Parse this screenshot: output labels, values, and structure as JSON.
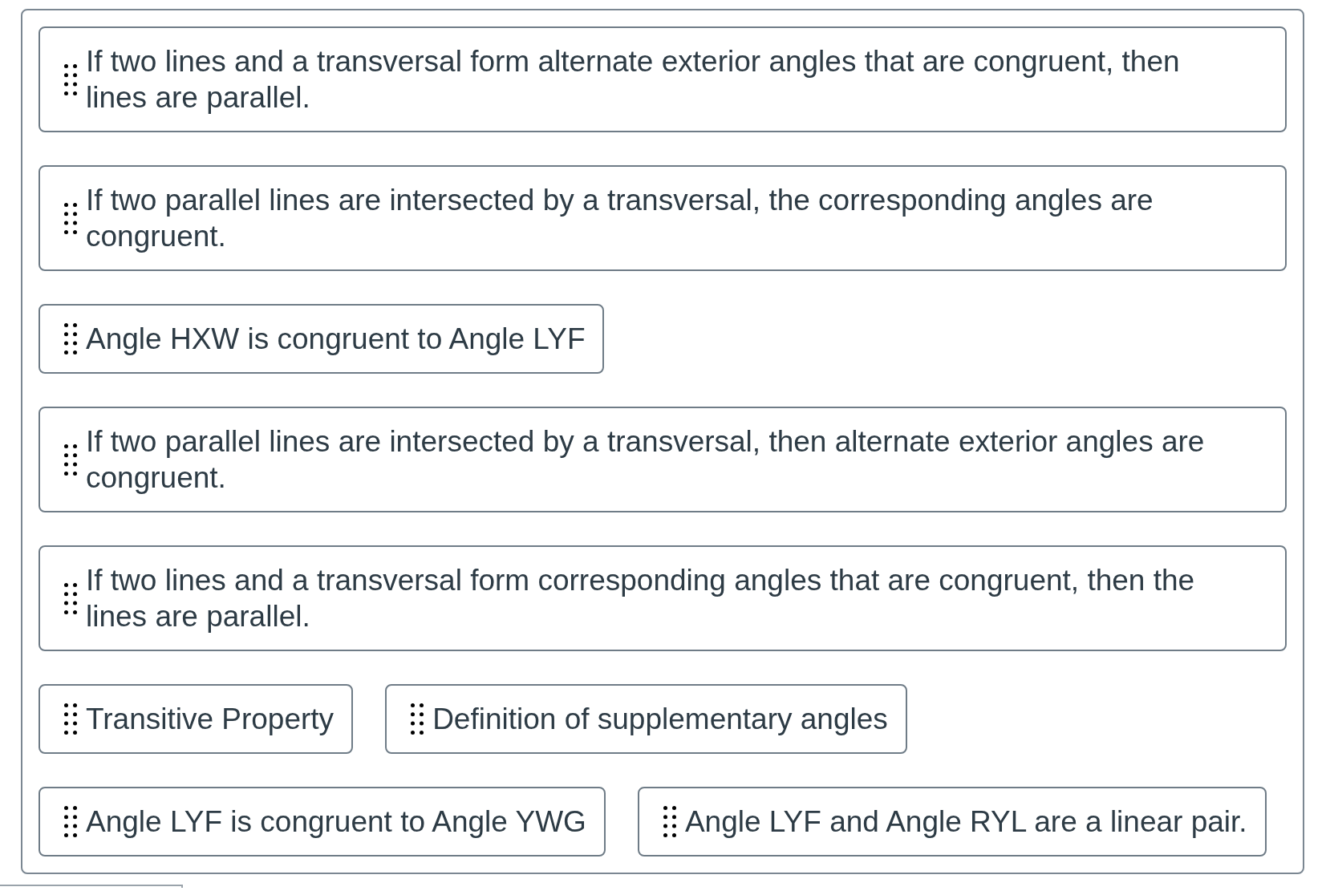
{
  "answer_bank": {
    "items": [
      {
        "text": "If two lines and a transversal form alternate exterior angles that are congruent, then lines are parallel."
      },
      {
        "text": "If two parallel lines are intersected by a transversal, the corresponding angles are congruent."
      },
      {
        "text": "Angle HXW is congruent to Angle LYF"
      },
      {
        "text": "If two parallel lines are intersected by a transversal, then alternate exterior angles are congruent."
      },
      {
        "text": "If two lines and a transversal form corresponding angles that are congruent, then the lines are parallel."
      },
      {
        "text": "Transitive Property"
      },
      {
        "text": "Definition of supplementary angles"
      },
      {
        "text": "Angle LYF is congruent to Angle YWG"
      },
      {
        "text": "Angle LYF and Angle RYL are a linear pair."
      }
    ]
  }
}
